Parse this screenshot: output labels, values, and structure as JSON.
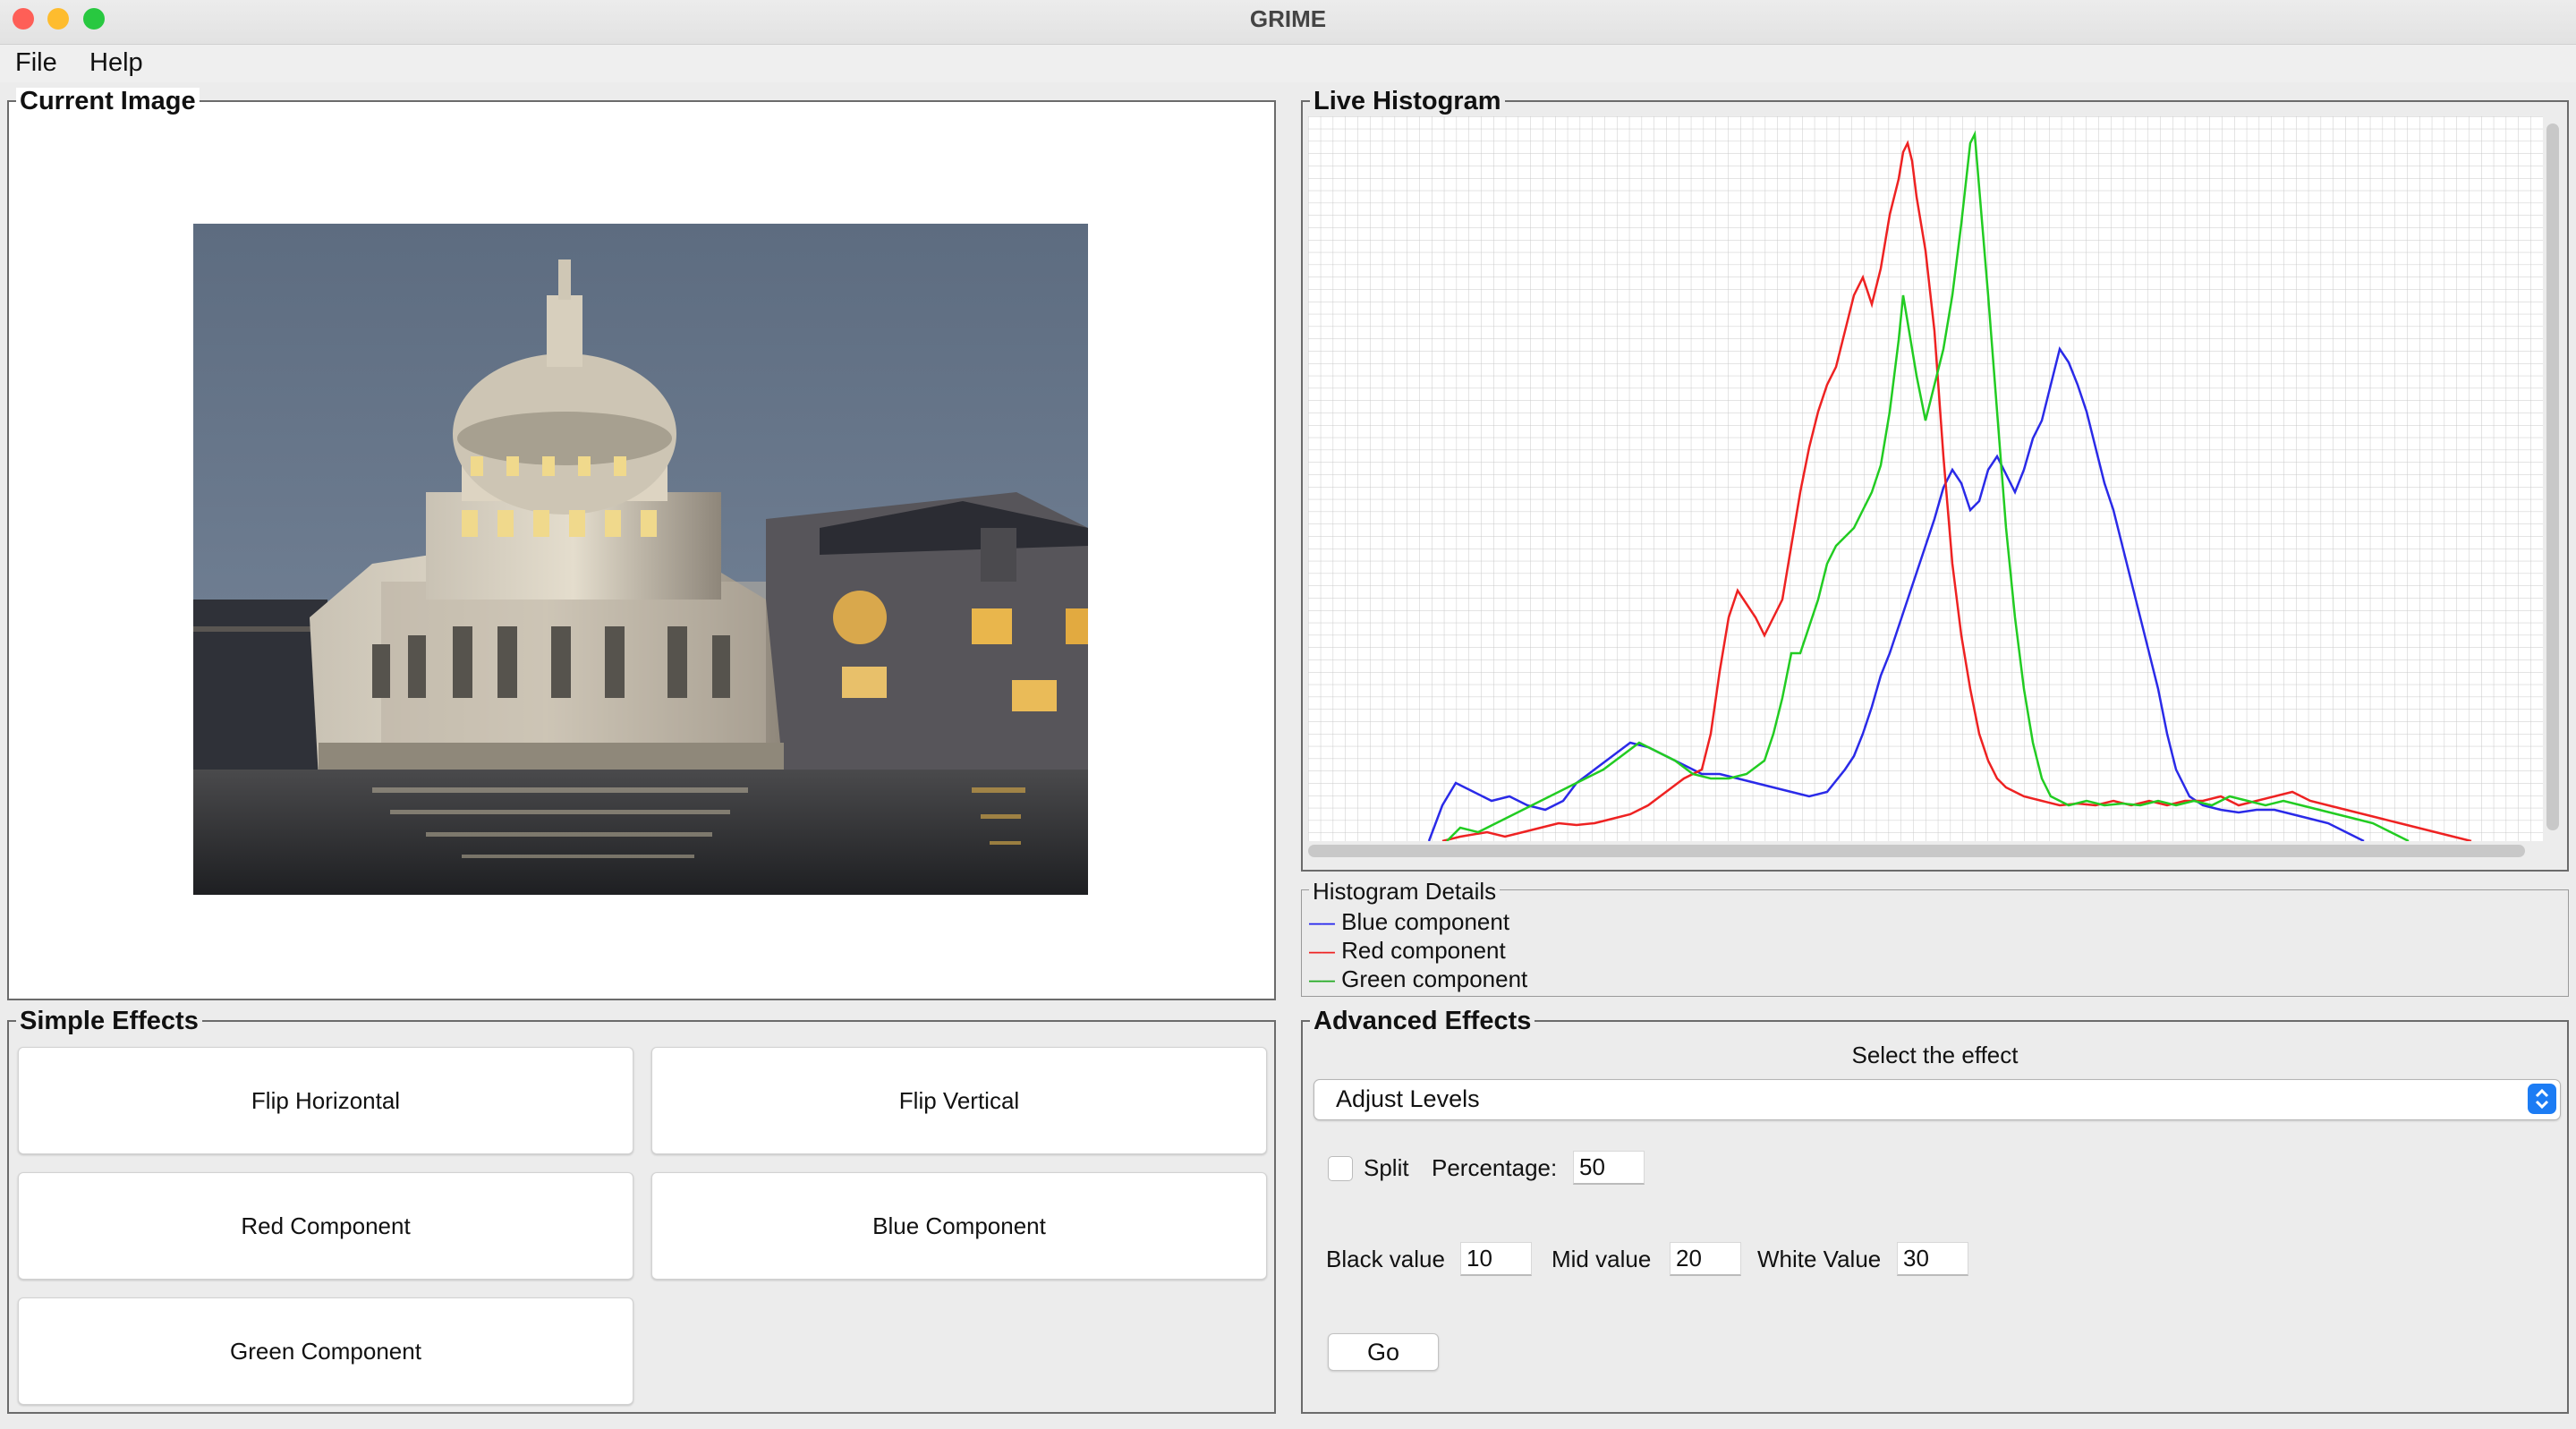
{
  "window": {
    "title": "GRIME"
  },
  "menu": [
    {
      "label": "File"
    },
    {
      "label": "Help"
    }
  ],
  "current_image": {
    "title": "Current Image",
    "image_alt": "Night photo of domed church building reflecting in a pool"
  },
  "live_histogram": {
    "title": "Live Histogram"
  },
  "histogram_details": {
    "title": "Histogram Details",
    "legend": [
      {
        "label": "Blue component",
        "color": "#2222ee"
      },
      {
        "label": "Red component",
        "color": "#ee2222"
      },
      {
        "label": "Green component",
        "color": "#22aa22"
      }
    ]
  },
  "simple_effects": {
    "title": "Simple Effects",
    "buttons": [
      {
        "label": "Flip Horizontal"
      },
      {
        "label": "Flip Vertical"
      },
      {
        "label": "Red Component"
      },
      {
        "label": "Blue Component"
      },
      {
        "label": "Green Component"
      }
    ]
  },
  "advanced_effects": {
    "title": "Advanced Effects",
    "select_label": "Select the effect",
    "selected_effect": "Adjust Levels",
    "split_label": "Split",
    "split_checked": false,
    "percentage_label": "Percentage:",
    "percentage_value": "50",
    "black_label": "Black value",
    "black_value": "10",
    "mid_label": "Mid value",
    "mid_value": "20",
    "white_label": "White Value",
    "white_value": "30",
    "go_label": "Go"
  },
  "colors": {
    "accent": "#1c7cf4",
    "close": "#fe5f57",
    "minimize": "#febc2e",
    "zoom": "#28c840"
  }
}
